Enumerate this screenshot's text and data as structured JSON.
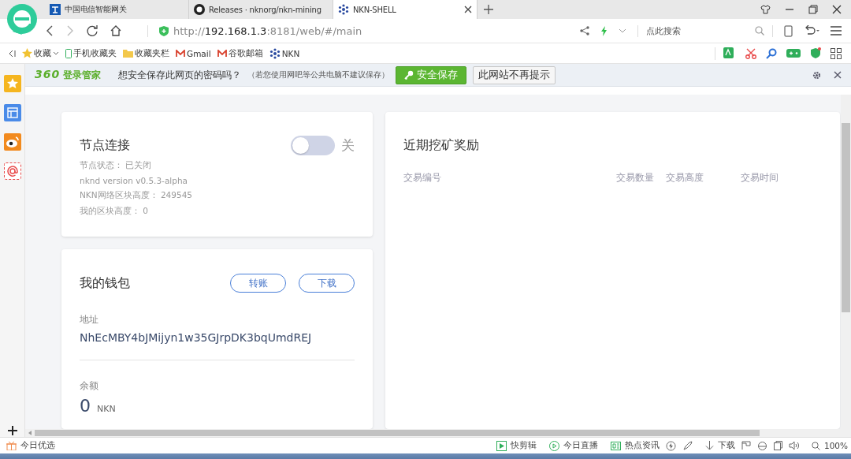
{
  "tabs": [
    {
      "title": "中国电信智能网关",
      "kind": "telecom",
      "selected": false
    },
    {
      "title": "Releases · nknorg/nkn-mining",
      "kind": "github",
      "selected": false
    },
    {
      "title": "NKN-SHELL",
      "kind": "nkn",
      "selected": true
    }
  ],
  "address_bar": {
    "url_prefix": "http://",
    "url_host": "192.168.1.3",
    "url_rest": ":8181/web/#/main",
    "search_placeholder": "点此搜索"
  },
  "bookmarks": [
    {
      "label": "收藏",
      "kind": "star"
    },
    {
      "label": "手机收藏夹",
      "kind": "phone"
    },
    {
      "label": "收藏夹栏",
      "kind": "folder"
    },
    {
      "label": "Gmail",
      "kind": "mail"
    },
    {
      "label": "谷歌邮箱",
      "kind": "mail"
    },
    {
      "label": "NKN",
      "kind": "nkn"
    }
  ],
  "password_bar": {
    "brand": "360",
    "brand_sub": "登录管家",
    "message": "想安全保存此网页的密码吗？",
    "note": "（若您使用网吧等公共电脑不建议保存）",
    "save_button": "安全保存",
    "never_button": "此网站不再提示"
  },
  "node_card": {
    "title": "节点连接",
    "switch_on": false,
    "switch_label": "关",
    "lines": [
      "节点状态： 已关闭",
      "nknd version v0.5.3-alpha",
      "NKN网络区块高度： 249545",
      "我的区块高度： 0"
    ]
  },
  "wallet": {
    "title": "我的钱包",
    "buttons": [
      "转账",
      "下载"
    ],
    "address_label": "地址",
    "address": "NhEcMBY4bJMijyn1w35GJrpDK3bqUmdREJ",
    "balance_label": "余额",
    "balance": "0",
    "unit": "NKN"
  },
  "rewards": {
    "title": "近期挖矿奖励",
    "columns": [
      "交易编号",
      "交易数量",
      "交易高度",
      "交易时间"
    ]
  },
  "status_bar": {
    "left": "今日优选",
    "items": [
      {
        "kind": "clip",
        "label": "快剪辑"
      },
      {
        "kind": "live",
        "label": "今日直播"
      },
      {
        "kind": "news",
        "label": "热点资讯"
      },
      {
        "kind": "download",
        "label": "下载"
      }
    ],
    "zoom": "100%"
  }
}
